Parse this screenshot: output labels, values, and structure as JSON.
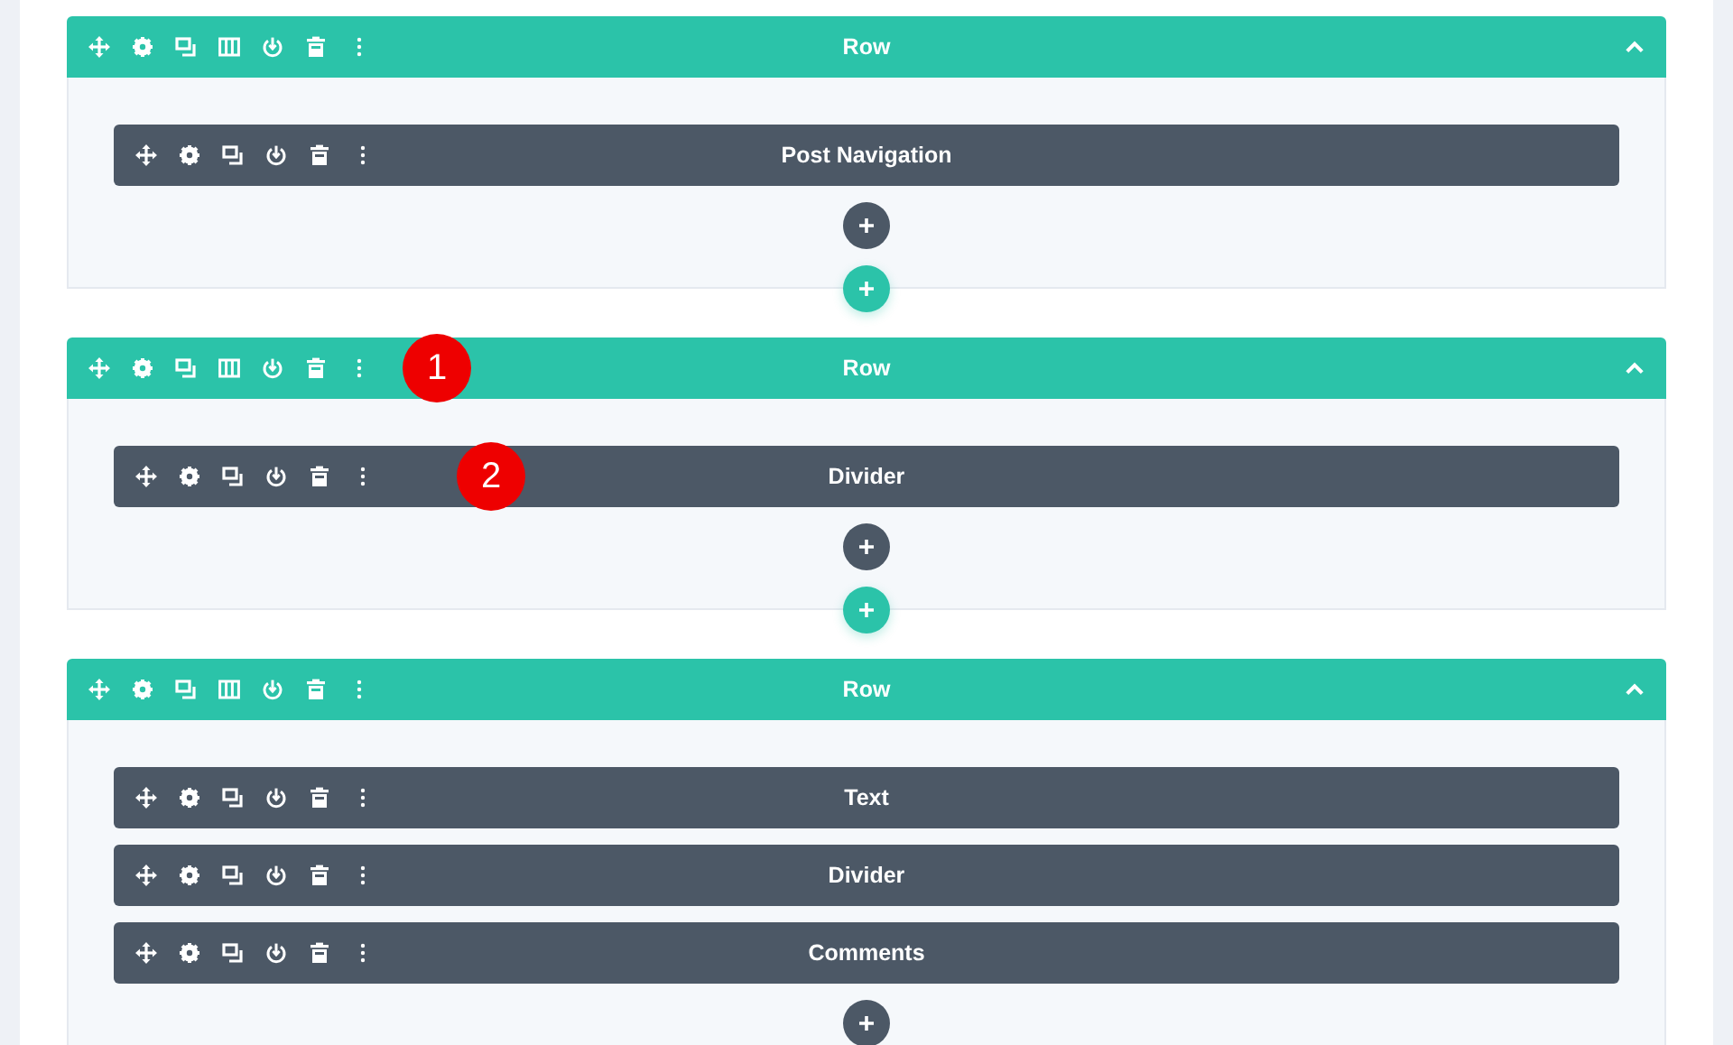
{
  "rows": [
    {
      "title": "Row",
      "modules": [
        {
          "title": "Post Navigation"
        }
      ]
    },
    {
      "title": "Row",
      "marker": "1",
      "modules": [
        {
          "title": "Divider",
          "marker": "2"
        }
      ]
    },
    {
      "title": "Row",
      "modules": [
        {
          "title": "Text"
        },
        {
          "title": "Divider"
        },
        {
          "title": "Comments"
        }
      ]
    }
  ]
}
